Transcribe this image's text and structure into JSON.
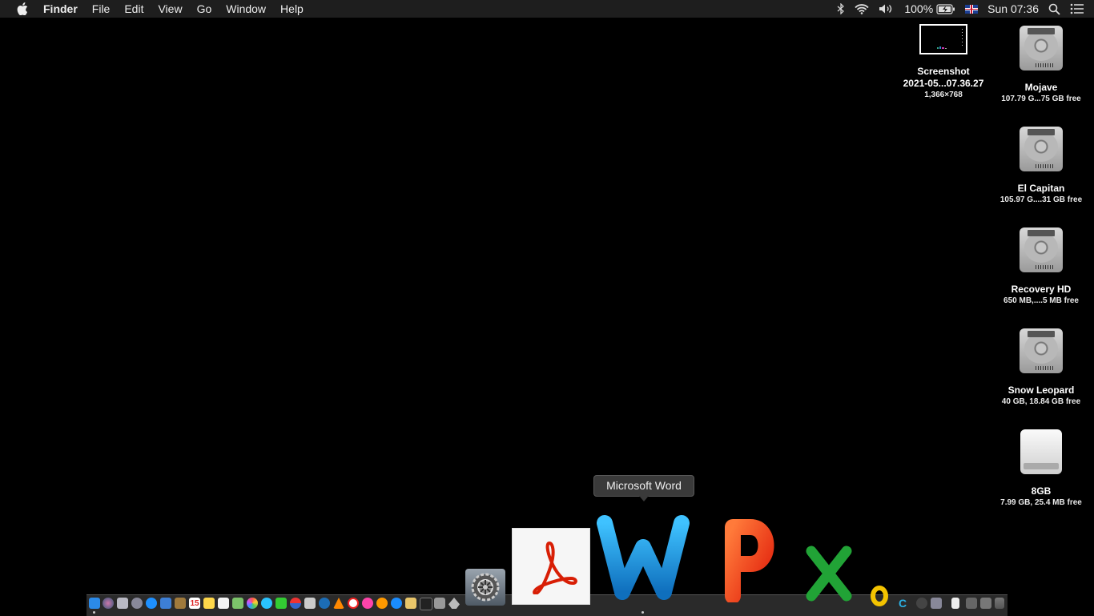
{
  "menubar": {
    "app_name": "Finder",
    "items": [
      "File",
      "Edit",
      "View",
      "Go",
      "Window",
      "Help"
    ],
    "status": {
      "battery": "100%",
      "clock": "Sun 07:36"
    }
  },
  "desktop_icons": [
    {
      "name": "Screenshot",
      "line2": "2021-05...07.36.27",
      "sub": "1,366×768",
      "kind": "screenshot"
    },
    {
      "name": "Mojave",
      "sub": "107.79 G...75 GB free",
      "kind": "hdd"
    },
    {
      "name": "El Capitan",
      "sub": "105.97 G....31 GB free",
      "kind": "hdd"
    },
    {
      "name": "Recovery HD",
      "sub": "650 MB,....5 MB free",
      "kind": "hdd"
    },
    {
      "name": "Snow Leopard",
      "sub": "40 GB, 18.84 GB free",
      "kind": "hdd"
    },
    {
      "name": "8GB",
      "sub": "7.99 GB, 25.4 MB free",
      "kind": "usb"
    }
  ],
  "tooltip": {
    "text": "Microsoft Word"
  },
  "dock": {
    "big_icons": [
      "system-preferences-icon",
      "adobe-acrobat-icon",
      "microsoft-word-icon",
      "microsoft-powerpoint-icon",
      "microsoft-excel-icon",
      "microsoft-outlook-icon"
    ],
    "calendar_day": "15"
  },
  "colors": {
    "word_blue": "#1aa0e8",
    "acrobat_red": "#d81e05",
    "powerpoint_red": "#ef3b1f",
    "excel_green": "#21a336",
    "outlook_yellow": "#f3c300"
  }
}
